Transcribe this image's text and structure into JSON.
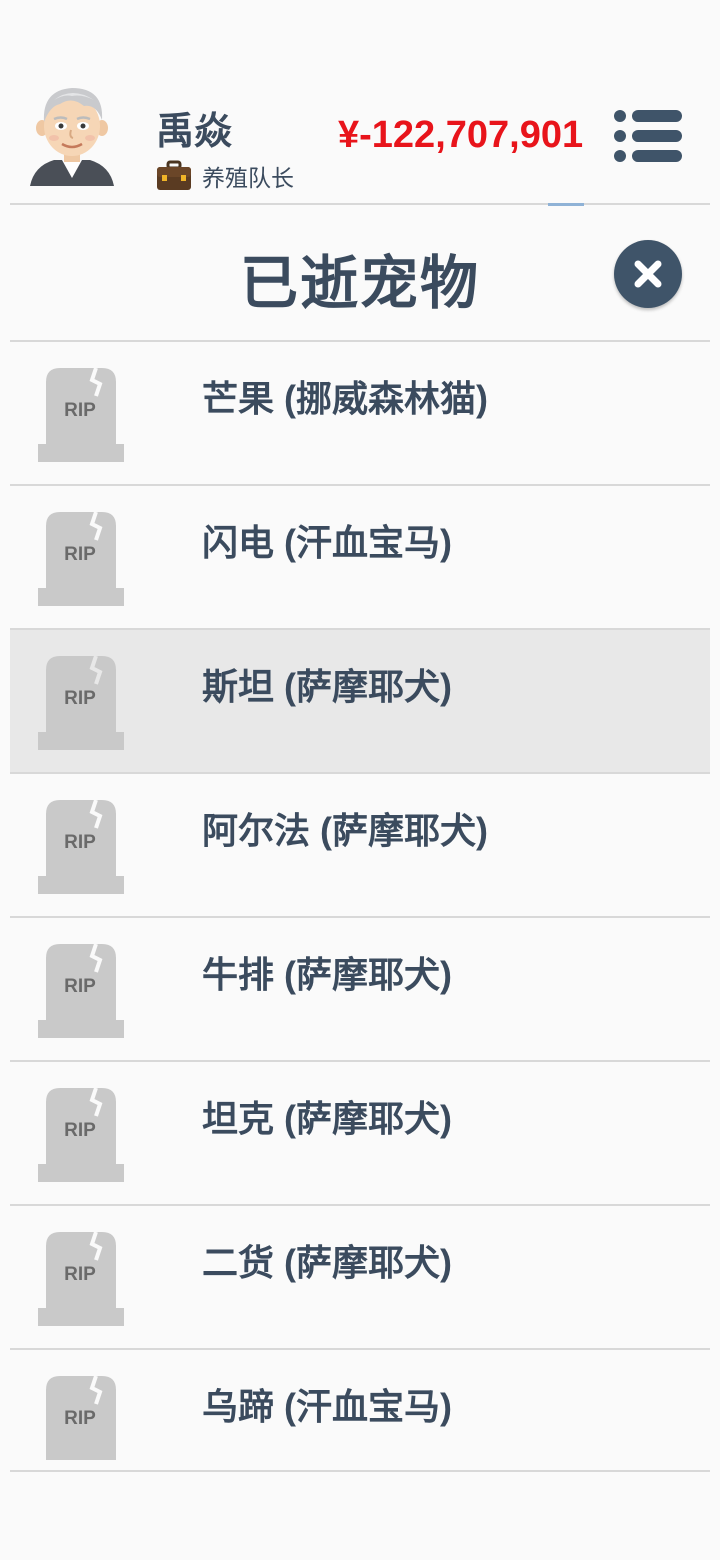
{
  "header": {
    "username": "禹焱",
    "player_title": "养殖队长",
    "money": "¥-122,707,901",
    "money_color": "#e8141b",
    "avatar_icon": "elderly-man-avatar",
    "title_icon": "briefcase-icon",
    "menu_icon": "menu-list-icon"
  },
  "dialog": {
    "title": "已逝宠物",
    "close_icon": "close-icon"
  },
  "tomb_text": "RIP",
  "pets": [
    {
      "name": "芒果 (挪威森林猫)"
    },
    {
      "name": "闪电 (汗血宝马)"
    },
    {
      "name": "斯坦 (萨摩耶犬)"
    },
    {
      "name": "阿尔法 (萨摩耶犬)"
    },
    {
      "name": "牛排 (萨摩耶犬)"
    },
    {
      "name": "坦克 (萨摩耶犬)"
    },
    {
      "name": "二货 (萨摩耶犬)"
    },
    {
      "name": "乌蹄 (汗血宝马)"
    }
  ]
}
